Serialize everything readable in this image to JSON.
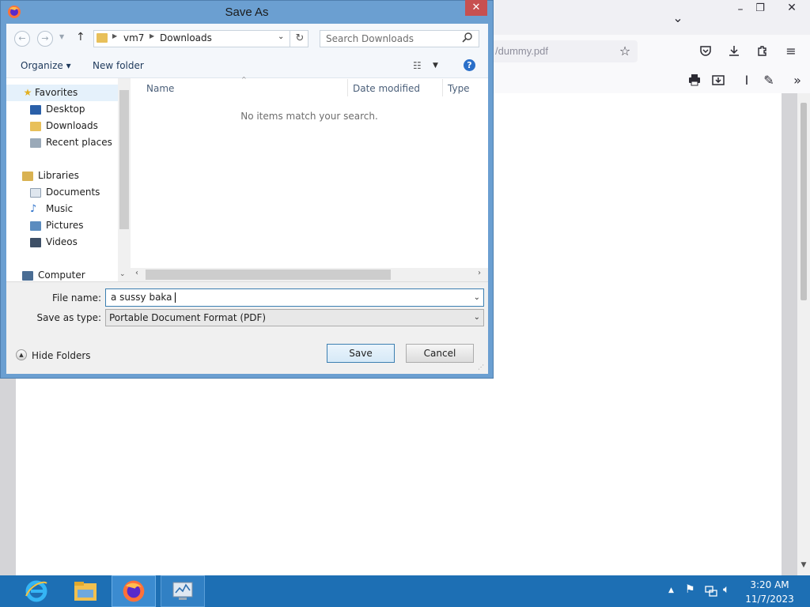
{
  "browser": {
    "url_fragment": "/dummy.pdf",
    "icons": [
      "chevron-down-icon",
      "minimize-icon",
      "restore-icon",
      "close-icon",
      "bookmark-star-icon",
      "pocket-icon",
      "download-icon",
      "extensions-icon",
      "menu-icon",
      "print-icon",
      "save-icon",
      "text-cursor-icon",
      "draw-icon",
      "more-tools-icon"
    ]
  },
  "dialog": {
    "title": "Save As",
    "close_glyph": "✕",
    "breadcrumb": [
      "vm7",
      "Downloads"
    ],
    "search_placeholder": "Search Downloads",
    "organize_label": "Organize ▾",
    "new_folder_label": "New folder",
    "nav": {
      "favorites": "Favorites",
      "desktop": "Desktop",
      "downloads": "Downloads",
      "recent": "Recent places",
      "libraries": "Libraries",
      "documents": "Documents",
      "music": "Music",
      "pictures": "Pictures",
      "videos": "Videos",
      "computer": "Computer"
    },
    "columns": {
      "name": "Name",
      "date_modified": "Date modified",
      "type": "Type"
    },
    "empty_message": "No items match your search.",
    "file_name_label": "File name:",
    "file_name_value": "a sussy baka",
    "save_type_label": "Save as type:",
    "save_type_value": "Portable Document Format (PDF)",
    "hide_folders_label": "Hide Folders",
    "save_label": "Save",
    "cancel_label": "Cancel"
  },
  "taskbar": {
    "time": "3:20 AM",
    "date": "11/7/2023"
  },
  "colors": {
    "dialog_frame": "#6b9fd1",
    "taskbar": "#1d6fb4",
    "close_button": "#c75050"
  }
}
